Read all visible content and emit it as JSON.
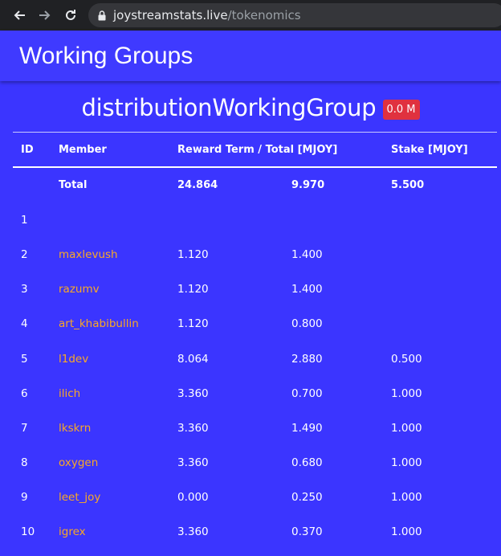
{
  "browser": {
    "url_host": "joystreamstats.live",
    "url_path": "/tokenomics"
  },
  "header": {
    "title": "Working Groups"
  },
  "group": {
    "name": "distributionWorkingGroup",
    "badge": "0.0 M"
  },
  "table": {
    "headers": {
      "id": "ID",
      "member": "Member",
      "reward": "Reward Term / Total [MJOY]",
      "stake": "Stake [MJOY]"
    },
    "total": {
      "label": "Total",
      "term": "24.864",
      "total": "9.970",
      "stake": "5.500"
    },
    "rows": [
      {
        "id": "1",
        "member": "",
        "term": "",
        "total": "",
        "stake": ""
      },
      {
        "id": "2",
        "member": "maxlevush",
        "term": "1.120",
        "total": "1.400",
        "stake": ""
      },
      {
        "id": "3",
        "member": "razumv",
        "term": "1.120",
        "total": "1.400",
        "stake": ""
      },
      {
        "id": "4",
        "member": "art_khabibullin",
        "term": "1.120",
        "total": "0.800",
        "stake": ""
      },
      {
        "id": "5",
        "member": "l1dev",
        "term": "8.064",
        "total": "2.880",
        "stake": "0.500"
      },
      {
        "id": "6",
        "member": "ilich",
        "term": "3.360",
        "total": "0.700",
        "stake": "1.000"
      },
      {
        "id": "7",
        "member": "lkskrn",
        "term": "3.360",
        "total": "1.490",
        "stake": "1.000"
      },
      {
        "id": "8",
        "member": "oxygen",
        "term": "3.360",
        "total": "0.680",
        "stake": "1.000"
      },
      {
        "id": "9",
        "member": "leet_joy",
        "term": "0.000",
        "total": "0.250",
        "stake": "1.000"
      },
      {
        "id": "10",
        "member": "igrex",
        "term": "3.360",
        "total": "0.370",
        "stake": "1.000"
      }
    ]
  }
}
